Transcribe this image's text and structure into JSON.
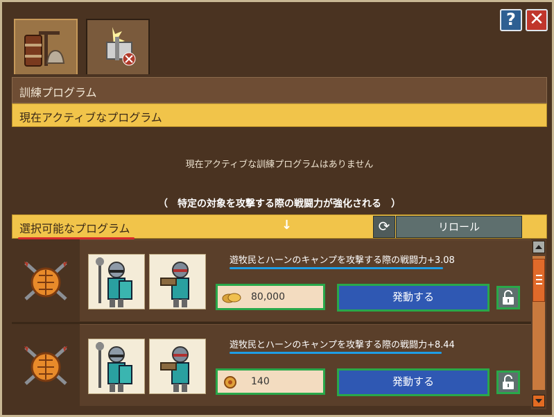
{
  "window": {
    "help_label": "?",
    "close_label": "✕"
  },
  "tabs": [
    {
      "name": "training-tab",
      "icon": "wooden-training-dummy-icon",
      "active": true
    },
    {
      "name": "deactivate-tab",
      "icon": "unit-cancel-icon",
      "active": false
    }
  ],
  "training": {
    "title": "訓練プログラム",
    "active_header": "現在アクティブなプログラム",
    "empty_message": "現在アクティブな訓練プログラムはありません",
    "bonus_note": "（　特定の対象を攻撃する際の戦闘力が強化される　）",
    "available_header": "選択可能なプログラム",
    "reroll_label": "リロール",
    "arrow": "↓"
  },
  "programs": [
    {
      "stat": "遊牧民とハーンのキャンプを攻撃する際の戦闘力+3.08",
      "cost_value": "80,000",
      "cost_icon": "coin-icon",
      "activate_label": "発動する"
    },
    {
      "stat": "遊牧民とハーンのキャンプを攻撃する際の戦闘力+8.44",
      "cost_value": "140",
      "cost_icon": "ruby-coin-icon",
      "activate_label": "発動する"
    }
  ],
  "colors": {
    "accent_yellow": "#f1c44a",
    "action_blue": "#2f58b3",
    "highlight_green": "#29a84a",
    "panel_brown": "#4a3321"
  }
}
